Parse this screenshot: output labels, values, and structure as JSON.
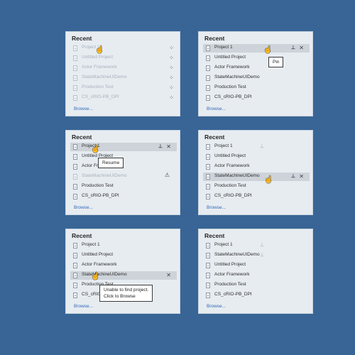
{
  "panels": [
    {
      "title": "Recent",
      "items": [
        "Project 1",
        "Untitled Project",
        "Actor Framework",
        "StateMachineUIDemo",
        "Production Test",
        "CS_cRIO-PB_DPI"
      ],
      "browse": "Browse..."
    },
    {
      "title": "Recent",
      "items": [
        "Project 1",
        "Untitled Project",
        "Actor Framework",
        "StateMachineUIDemo",
        "Production Test",
        "CS_cRIO-PB_DPI"
      ],
      "browse": "Browse...",
      "tooltip": "Pin"
    },
    {
      "title": "Recent",
      "items": [
        "Project 1",
        "Untitled Project",
        "Actor Framework",
        "StateMachineUIDemo",
        "Production Test",
        "CS_cRIO-PB_DPI"
      ],
      "browse": "Browse...",
      "tooltip": "Resume"
    },
    {
      "title": "Recent",
      "items": [
        "Project 1",
        "Untitled Project",
        "Actor Framework",
        "StateMachineUIDemo",
        "Production Test",
        "CS_cRIO-PB_DPI"
      ],
      "browse": "Browse..."
    },
    {
      "title": "Recent",
      "items": [
        "Project 1",
        "Untitled Project",
        "Actor Framework",
        "StateMachineUIDemo",
        "Production Test",
        "CS_cRIO-PB_DPI"
      ],
      "browse": "Browse...",
      "tooltip_line1": "Unable to find project.",
      "tooltip_line2": "Click to Browse"
    },
    {
      "title": "Recent",
      "items": [
        "Project 1",
        "StateMachineUIDemo",
        "Untitled Project",
        "Actor Framework",
        "Production Test",
        "CS_cRIO-PB_DPI"
      ],
      "browse": "Browse..."
    }
  ],
  "icons": {
    "spinner": "loading-spinner-icon",
    "pin": "pin-icon",
    "close": "close-icon",
    "warning": "warning-icon",
    "file": "project-file-icon",
    "cursor": "hand-cursor-icon"
  },
  "colors": {
    "background": "#386596",
    "panel": "#e7ecf1",
    "highlight": "#cdd3d9",
    "link": "#2f6ab5"
  }
}
